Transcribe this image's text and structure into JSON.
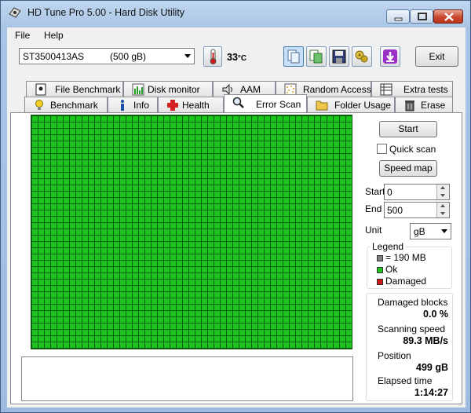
{
  "window": {
    "title": "HD Tune Pro 5.00 - Hard Disk Utility"
  },
  "menu": {
    "file": "File",
    "help": "Help"
  },
  "toolbar": {
    "drive_name": "ST3500413AS",
    "drive_size": "(500 gB)",
    "temperature": "33",
    "temperature_unit": "°C",
    "exit_label": "Exit",
    "icons": [
      "thermometer-icon",
      "copy-text-icon",
      "copy-screenshot-icon",
      "save-icon",
      "options-icon",
      "download-icon"
    ]
  },
  "tabs_back": [
    {
      "label": "File Benchmark",
      "icon": "file-benchmark-icon"
    },
    {
      "label": "Disk monitor",
      "icon": "disk-monitor-icon"
    },
    {
      "label": "AAM",
      "icon": "speaker-icon"
    },
    {
      "label": "Random Access",
      "icon": "random-access-icon"
    },
    {
      "label": "Extra tests",
      "icon": "extra-tests-icon"
    }
  ],
  "tabs_front": [
    {
      "label": "Benchmark",
      "icon": "lightbulb-icon"
    },
    {
      "label": "Info",
      "icon": "info-icon"
    },
    {
      "label": "Health",
      "icon": "health-cross-icon"
    },
    {
      "label": "Error Scan",
      "icon": "magnifier-icon",
      "active": true
    },
    {
      "label": "Folder Usage",
      "icon": "folder-icon"
    },
    {
      "label": "Erase",
      "icon": "trash-icon"
    }
  ],
  "scan": {
    "start_button": "Start",
    "quick_scan_label": "Quick scan",
    "quick_scan_checked": false,
    "speed_map_button": "Speed map",
    "start_label": "Start",
    "start_value": "0",
    "end_label": "End",
    "end_value": "500",
    "unit_label": "Unit",
    "unit_value": "gB",
    "block_state": "all-ok"
  },
  "legend": {
    "title": "Legend",
    "items": [
      {
        "label": "= 190 MB",
        "color": "#808080"
      },
      {
        "label": "Ok",
        "color": "#1ec41e"
      },
      {
        "label": "Damaged",
        "color": "#d01818"
      }
    ]
  },
  "stats": {
    "damaged_blocks_label": "Damaged blocks",
    "damaged_blocks_value": "0.0 %",
    "scanning_speed_label": "Scanning speed",
    "scanning_speed_value": "89.3 MB/s",
    "position_label": "Position",
    "position_value": "499 gB",
    "elapsed_label": "Elapsed time",
    "elapsed_value": "1:14:27"
  },
  "colors": {
    "ok_block": "#1ec41e",
    "grid_line": "#0b5e0b",
    "damaged_block": "#d01818"
  }
}
